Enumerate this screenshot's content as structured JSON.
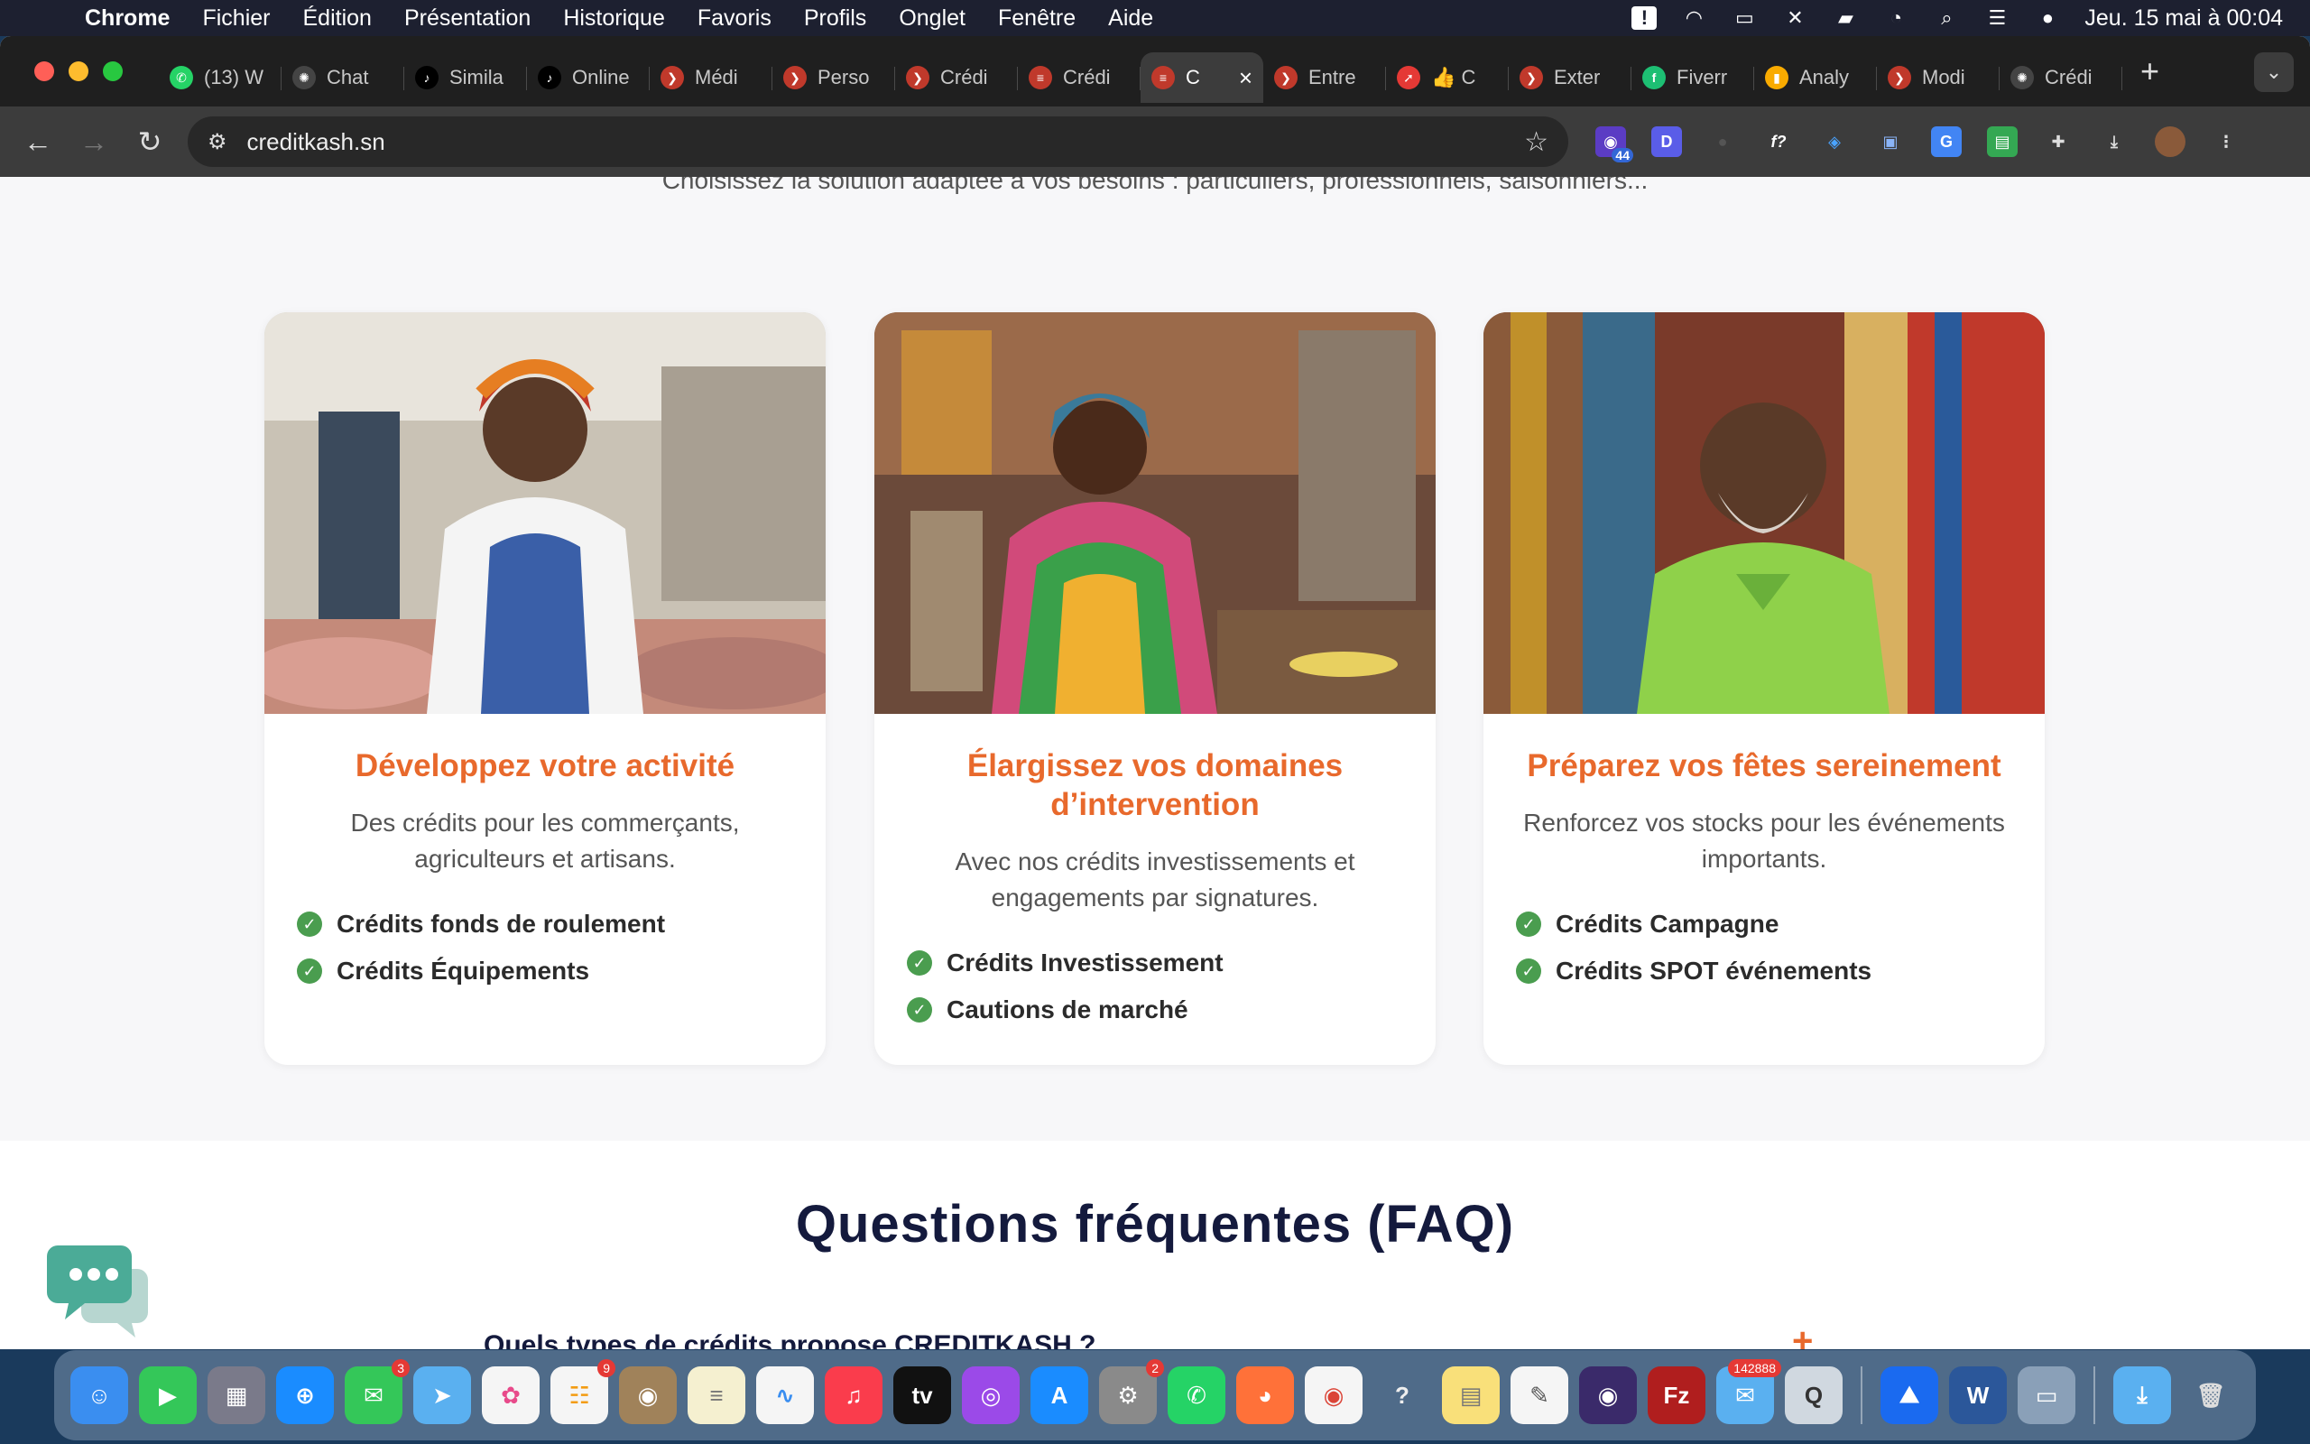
{
  "menubar": {
    "app": "Chrome",
    "items": [
      "Fichier",
      "Édition",
      "Présentation",
      "Historique",
      "Favoris",
      "Profils",
      "Onglet",
      "Fenêtre",
      "Aide"
    ],
    "clock": "Jeu. 15 mai à 00:04"
  },
  "tabs": [
    {
      "label": "(13) W",
      "color": "#25d366",
      "glyph": "✆"
    },
    {
      "label": "Chat",
      "color": "#444",
      "glyph": "✺"
    },
    {
      "label": "Simila",
      "color": "#000",
      "glyph": "♪"
    },
    {
      "label": "Online",
      "color": "#000",
      "glyph": "♪"
    },
    {
      "label": "Médi",
      "color": "#c0392b",
      "glyph": "❯"
    },
    {
      "label": "Perso",
      "color": "#c0392b",
      "glyph": "❯"
    },
    {
      "label": "Crédi",
      "color": "#c0392b",
      "glyph": "❯"
    },
    {
      "label": "Crédi",
      "color": "#c0392b",
      "glyph": "≡"
    },
    {
      "label": "C",
      "color": "#c0392b",
      "glyph": "≡",
      "active": true
    },
    {
      "label": "Entre",
      "color": "#c0392b",
      "glyph": "❯"
    },
    {
      "label": "👍 C",
      "color": "#e53935",
      "glyph": "➚"
    },
    {
      "label": "Exter",
      "color": "#c0392b",
      "glyph": "❯"
    },
    {
      "label": "Fiverr",
      "color": "#1dbf73",
      "glyph": "f"
    },
    {
      "label": "Analy",
      "color": "#f9ab00",
      "glyph": "▮"
    },
    {
      "label": "Modi",
      "color": "#c0392b",
      "glyph": "❯"
    },
    {
      "label": "Crédi",
      "color": "#444",
      "glyph": "✺"
    }
  ],
  "toolbar": {
    "url": "creditkash.sn",
    "ext_badge": "44"
  },
  "page": {
    "subtitle": "Choisissez la solution adaptée à vos besoins : particuliers, professionnels, saisonniers...",
    "cards": [
      {
        "title": "Développez votre activité",
        "description": "Des crédits pour les commerçants, agriculteurs et artisans.",
        "features": [
          "Crédits fonds de roulement",
          "Crédits Équipements"
        ]
      },
      {
        "title": "Élargissez vos domaines d’intervention",
        "description": "Avec nos crédits investissements et engagements par signatures.",
        "features": [
          "Crédits Investissement",
          "Cautions de marché"
        ]
      },
      {
        "title": "Préparez vos fêtes sereinement",
        "description": "Renforcez vos stocks pour les événements importants.",
        "features": [
          "Crédits Campagne",
          "Crédits SPOT événements"
        ]
      }
    ],
    "faq_title": "Questions fréquentes (FAQ)",
    "faq_question": "Quels types de crédits propose CREDITKASH ?",
    "faq_toggle": "+"
  },
  "dock": {
    "messages_badge": "3",
    "reminders_badge": "9",
    "settings_badge": "2",
    "mail_badge": "142888"
  }
}
